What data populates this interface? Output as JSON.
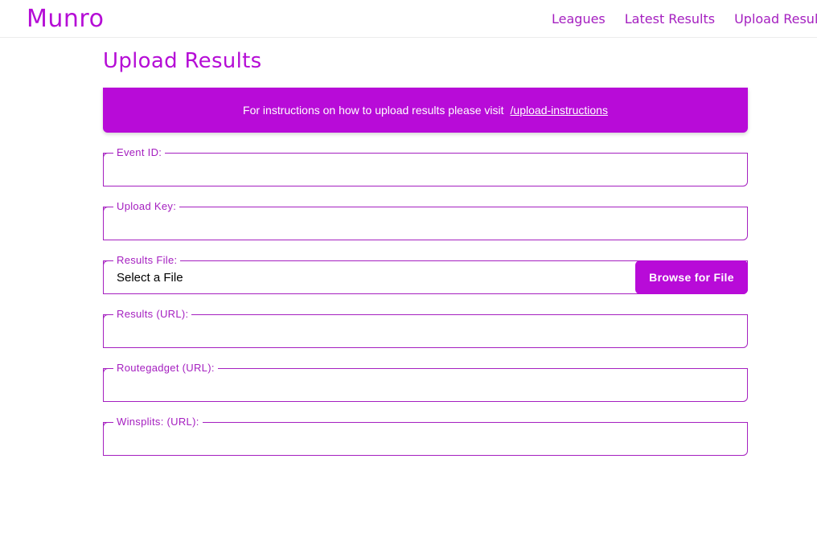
{
  "app": {
    "logo": "Munro"
  },
  "nav": {
    "items": [
      {
        "label": "Leagues"
      },
      {
        "label": "Latest Results"
      },
      {
        "label": "Upload Results"
      }
    ]
  },
  "page": {
    "title": "Upload Results"
  },
  "banner": {
    "text": "For instructions on how to upload results please visit",
    "link_text": "/upload-instructions"
  },
  "form": {
    "event_id": {
      "label": "Event ID:",
      "value": ""
    },
    "upload_key": {
      "label": "Upload Key:",
      "value": ""
    },
    "results_file": {
      "label": "Results File:",
      "value": "Select a File",
      "button_label": "Browse for File"
    },
    "results_url": {
      "label": "Results (URL):",
      "value": ""
    },
    "routegadget_url": {
      "label": "Routegadget (URL):",
      "value": ""
    },
    "winsplits_url": {
      "label": "Winsplits: (URL):",
      "value": ""
    }
  },
  "colors": {
    "brand": "#b80bd8",
    "text_accent": "#a520c0"
  }
}
